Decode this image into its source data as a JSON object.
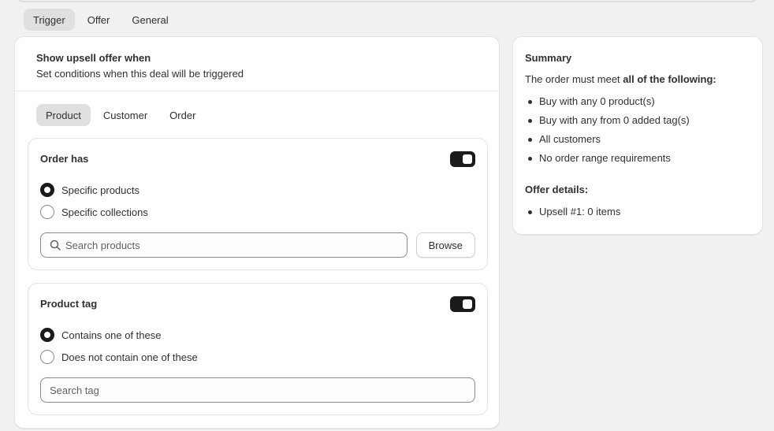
{
  "main_tabs": [
    {
      "label": "Trigger",
      "active": true
    },
    {
      "label": "Offer",
      "active": false
    },
    {
      "label": "General",
      "active": false
    }
  ],
  "trigger_card": {
    "title": "Show upsell offer when",
    "subtitle": "Set conditions when this deal will be triggered"
  },
  "sub_tabs": [
    {
      "label": "Product",
      "active": true
    },
    {
      "label": "Customer",
      "active": false
    },
    {
      "label": "Order",
      "active": false
    }
  ],
  "order_has": {
    "title": "Order has",
    "toggle_on": true,
    "options": [
      {
        "label": "Specific products",
        "checked": true
      },
      {
        "label": "Specific collections",
        "checked": false
      }
    ],
    "search_placeholder": "Search products",
    "browse_label": "Browse"
  },
  "product_tag": {
    "title": "Product tag",
    "toggle_on": true,
    "options": [
      {
        "label": "Contains one of these",
        "checked": true
      },
      {
        "label": "Does not contain one of these",
        "checked": false
      }
    ],
    "search_placeholder": "Search tag"
  },
  "summary": {
    "title": "Summary",
    "intro_prefix": "The order must meet ",
    "intro_bold": "all of the following:",
    "items": [
      "Buy with any 0 product(s)",
      "Buy with any from 0 added tag(s)",
      "All customers",
      "No order range requirements"
    ],
    "offer_title": "Offer details:",
    "offer_items": [
      "Upsell #1: 0 items"
    ]
  }
}
